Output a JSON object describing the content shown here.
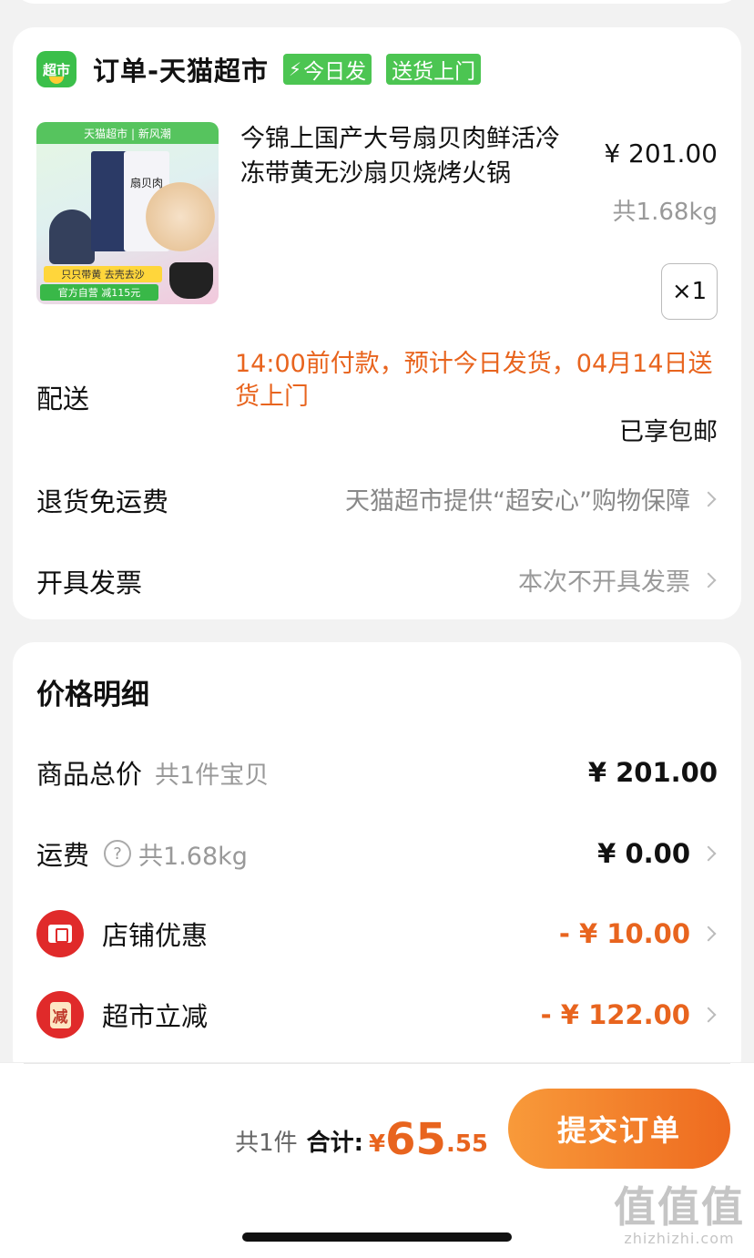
{
  "order": {
    "shop_logo_text": "超市",
    "shop_name": "订单-天猫超市",
    "tags": [
      "今日发",
      "送货上门"
    ],
    "product": {
      "image_banner": "天猫超市 | 新风潮",
      "image_box_label": "扇贝肉",
      "image_promo_1": "只只带黄 去壳去沙",
      "image_promo_2": "官方自营 减115元",
      "title": "今锦上国产大号扇贝肉鲜活冷冻带黄无沙扇贝烧烤火锅",
      "price": "¥ 201.00",
      "weight": "共1.68kg",
      "quantity": "×1"
    },
    "delivery": {
      "label": "配送",
      "text": "14:00前付款，预计今日发货，04月14日送货上门",
      "free_shipping": "已享包邮"
    },
    "return_row": {
      "label": "退货免运费",
      "value": "天猫超市提供“超安心”购物保障"
    },
    "invoice_row": {
      "label": "开具发票",
      "value": "本次不开具发票"
    }
  },
  "price_detail": {
    "title": "价格明细",
    "rows": [
      {
        "label": "商品总价",
        "sub": "共1件宝贝",
        "value": "¥ 201.00"
      },
      {
        "label": "运费",
        "sub": "共1.68kg",
        "value": "¥ 0.00"
      },
      {
        "label": "店铺优惠",
        "value": "- ¥ 10.00"
      },
      {
        "label": "超市立减",
        "value": "- ¥ 122.00",
        "icon_text": "减"
      }
    ]
  },
  "footer": {
    "count": "共1件",
    "total_label": "合计:",
    "currency": "¥",
    "total_int": "65",
    "total_dec": ".55",
    "submit_label": "提交订单"
  },
  "watermark": {
    "big": "值值值",
    "small": "zhizhizhi.com"
  },
  "colors": {
    "accent": "#e8641e",
    "green": "#4cc552",
    "red": "#e02a2a"
  }
}
